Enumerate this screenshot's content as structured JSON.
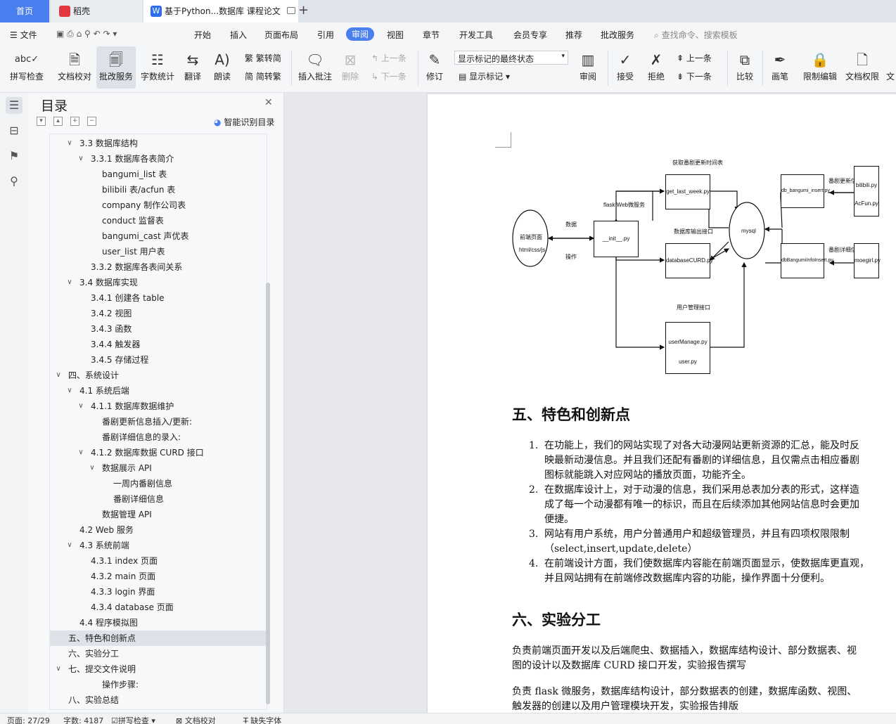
{
  "tabs": {
    "home": "首页",
    "daoke": "稻壳",
    "doc": "基于Python...数据库 课程论文"
  },
  "menu": {
    "file": "文件",
    "items": [
      "开始",
      "插入",
      "页面布局",
      "引用",
      "审阅",
      "视图",
      "章节",
      "开发工具",
      "会员专享",
      "推荐",
      "批改服务"
    ],
    "active": "审阅",
    "search": "查找命令、搜索模板"
  },
  "toolbar": {
    "spellcheck": "拼写检查",
    "doccheck": "文档校对",
    "grading": "批改服务",
    "wordcount": "字数统计",
    "translate": "翻译",
    "read": "朗读",
    "trad": "繁转简",
    "simp": "简转繁",
    "insert_comment": "插入批注",
    "delete": "删除",
    "prev_comment": "上一条",
    "next_comment": "下一条",
    "revise": "修订",
    "markup_state": "显示标记的最终状态",
    "show_markup": "显示标记",
    "review": "审阅",
    "accept": "接受",
    "reject": "拒绝",
    "prev": "上一条",
    "next": "下一条",
    "compare": "比较",
    "pen": "画笔",
    "restrict": "限制编辑",
    "perm": "文档权限",
    "wen": "文"
  },
  "toc": {
    "title": "目录",
    "smart": "智能识别目录",
    "items": [
      {
        "text": "3.3  数据库结构",
        "lvl": 1,
        "arrow": true
      },
      {
        "text": "3.3.1  数据库各表简介",
        "lvl": 2,
        "arrow": true
      },
      {
        "text": "bangumi_list 表",
        "lvl": 3,
        "arrow": false
      },
      {
        "text": "bilibili 表/acfun 表",
        "lvl": 3,
        "arrow": false
      },
      {
        "text": "company 制作公司表",
        "lvl": 3,
        "arrow": false
      },
      {
        "text": "conduct 监督表",
        "lvl": 3,
        "arrow": false
      },
      {
        "text": "bangumi_cast 声优表",
        "lvl": 3,
        "arrow": false
      },
      {
        "text": "user_list 用户表",
        "lvl": 3,
        "arrow": false
      },
      {
        "text": "3.3.2  数据库各表间关系",
        "lvl": 2,
        "arrow": false
      },
      {
        "text": "3.4  数据库实现",
        "lvl": 1,
        "arrow": true
      },
      {
        "text": "3.4.1  创建各 table",
        "lvl": 2,
        "arrow": false
      },
      {
        "text": "3.4.2  视图",
        "lvl": 2,
        "arrow": false
      },
      {
        "text": "3.4.3  函数",
        "lvl": 2,
        "arrow": false
      },
      {
        "text": "3.4.4  触发器",
        "lvl": 2,
        "arrow": false
      },
      {
        "text": "3.4.5  存储过程",
        "lvl": 2,
        "arrow": false
      },
      {
        "text": "四、系统设计",
        "lvl": 0,
        "arrow": true
      },
      {
        "text": "4.1  系统后端",
        "lvl": 1,
        "arrow": true
      },
      {
        "text": "4.1.1  数据库数据维护",
        "lvl": 2,
        "arrow": true
      },
      {
        "text": "番剧更新信息插入/更新:",
        "lvl": 3,
        "arrow": false
      },
      {
        "text": "番剧详细信息的录入:",
        "lvl": 3,
        "arrow": false
      },
      {
        "text": "4.1.2  数据库数据 CURD 接口",
        "lvl": 2,
        "arrow": true
      },
      {
        "text": "数据展示 API",
        "lvl": 3,
        "arrow": true
      },
      {
        "text": "一周内番剧信息",
        "lvl": 4,
        "arrow": false
      },
      {
        "text": "番剧详细信息",
        "lvl": 4,
        "arrow": false
      },
      {
        "text": "数据管理 API",
        "lvl": 3,
        "arrow": false
      },
      {
        "text": "4.2 Web 服务",
        "lvl": 1,
        "arrow": false
      },
      {
        "text": "4.3  系统前端",
        "lvl": 1,
        "arrow": true
      },
      {
        "text": "4.3.1 index 页面",
        "lvl": 2,
        "arrow": false
      },
      {
        "text": "4.3.2 main 页面",
        "lvl": 2,
        "arrow": false
      },
      {
        "text": "4.3.3 login 界面",
        "lvl": 2,
        "arrow": false
      },
      {
        "text": "4.3.4 database 页面",
        "lvl": 2,
        "arrow": false
      },
      {
        "text": "4.4  程序模拟图",
        "lvl": 1,
        "arrow": false
      },
      {
        "text": "五、特色和创新点",
        "lvl": 0,
        "arrow": false,
        "sel": true
      },
      {
        "text": "六、实验分工",
        "lvl": 0,
        "arrow": false
      },
      {
        "text": "七、提交文件说明",
        "lvl": 0,
        "arrow": true
      },
      {
        "text": "操作步骤:",
        "lvl": 3,
        "arrow": false
      },
      {
        "text": "八、实验总结",
        "lvl": 0,
        "arrow": false
      }
    ]
  },
  "diagram": {
    "frontend": {
      "l1": "前端页面",
      "l2": "html/css/js"
    },
    "data_label": "数据",
    "op_label": "操作",
    "flask_label": "flask Web微服务",
    "init": "__init__.py",
    "fetch_label": "获取番剧更新时间表",
    "get_week": "get_last_week.py",
    "dbapi_label": "数据库输出接口",
    "curd": "databaseCURD.py",
    "user_label": "用户管理接口",
    "user1": "userManage.py",
    "user2": "user.py",
    "mysql": "mysql",
    "update_label": "番剧更新信息",
    "insert1": "db_bangumi_insert.py",
    "detail_label": "番剧详细信息",
    "insert2": "dbBangumiInfoInsert.py",
    "src1a": "bilibili.py",
    "src1b": "AcFun.py",
    "src2": "moegirl.py"
  },
  "doc": {
    "h5": "五、特色和创新点",
    "list": [
      {
        "n": "1.",
        "lines": [
          "在功能上，我们的网站实现了对各大动漫网站更新资源的汇总，能及时反",
          "映最新动漫信息。并且我们还配有番剧的详细信息，且仅需点击相应番剧",
          "图标就能跳入对应网站的播放页面，功能齐全。"
        ]
      },
      {
        "n": "2.",
        "lines": [
          "在数据库设计上，对于动漫的信息，我们采用总表加分表的形式，这样造",
          "成了每一个动漫都有唯一的标识，而且在后续添加其他网站信息时会更加",
          "便捷。"
        ]
      },
      {
        "n": "3.",
        "lines": [
          "网站有用户系统，用户分普通用户和超级管理员，并且有四项权限限制",
          "（select,insert,update,delete）"
        ]
      },
      {
        "n": "4.",
        "lines": [
          "在前端设计方面，我们使数据库内容能在前端页面显示，使数据库更直观，",
          "并且网站拥有在前端修改数据库内容的功能，操作界面十分便利。"
        ]
      }
    ],
    "h6": "六、实验分工",
    "p1": [
      "负责前端页面开发以及后端爬虫、数据插入，数据库结构设计、部分数据表、视",
      "图的设计以及数据库 CURD 接口开发，实验报告撰写"
    ],
    "p2": [
      "负责 flask 微服务，数据库结构设计，部分数据表的创建，数据库函数、视图、",
      "触发器的创建以及用户管理模块开发，实验报告排版"
    ]
  },
  "status": {
    "page": "页面: 27/29",
    "words": "字数: 4187",
    "spell": "拼写检查",
    "doccheck": "文档校对",
    "font": "缺失字体"
  },
  "colors": {
    "accent": "#4a7ff0",
    "tab_bg": "#dfe3ea",
    "doc_bg": "#e6e8eb"
  }
}
